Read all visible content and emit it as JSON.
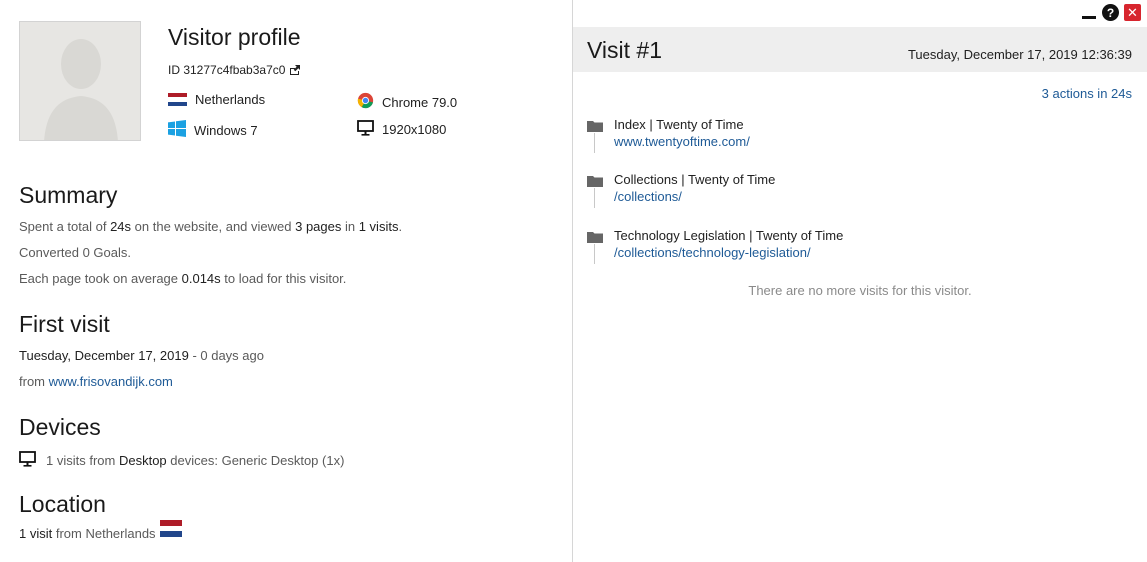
{
  "profile": {
    "title": "Visitor profile",
    "id_text": "ID 31277c4fbab3a7c0",
    "country": "Netherlands",
    "browser": "Chrome 79.0",
    "os": "Windows 7",
    "resolution": "1920x1080"
  },
  "summary": {
    "title": "Summary",
    "line1_pre": "Spent a total of ",
    "time_total": "24s",
    "line1_mid": " on the website, and viewed ",
    "pages": "3 pages",
    "line1_in": " in ",
    "visits": "1 visits",
    "line1_end": ".",
    "goals": "Converted 0 Goals.",
    "line3_pre": "Each page took on average ",
    "avg_load": "0.014s",
    "line3_end": " to load for this visitor."
  },
  "first_visit": {
    "title": "First visit",
    "date": "Tuesday, December 17, 2019",
    "ago": " - 0 days ago",
    "from_label": "from ",
    "referrer": "www.frisovandijk.com"
  },
  "devices": {
    "title": "Devices",
    "pre": "1 visits from ",
    "type": "Desktop",
    "post": " devices: Generic Desktop (1x)"
  },
  "location": {
    "title": "Location",
    "count": "1 visit",
    "text": " from Netherlands"
  },
  "visit": {
    "title": "Visit #1",
    "date": "Tuesday, December 17, 2019 12:36:39",
    "actions_summary": "3 actions in 24s",
    "actions": [
      {
        "title": "Index | Twenty of Time",
        "url": "www.twentyoftime.com/"
      },
      {
        "title": "Collections | Twenty of Time",
        "url": "/collections/"
      },
      {
        "title": "Technology Legislation | Twenty of Time",
        "url": "/collections/technology-legislation/"
      }
    ],
    "no_more": "There are no more visits for this visitor."
  },
  "controls": {
    "help": "?",
    "close": "✕"
  },
  "colors": {
    "accent_link": "#1e5a96",
    "close_red": "#d7252e",
    "header_bg": "#eeeeee"
  },
  "icons": [
    "external-link-icon",
    "netherlands-flag-icon",
    "chrome-icon",
    "windows-icon",
    "monitor-icon",
    "folder-icon",
    "help-icon",
    "close-icon",
    "minimize-icon"
  ]
}
